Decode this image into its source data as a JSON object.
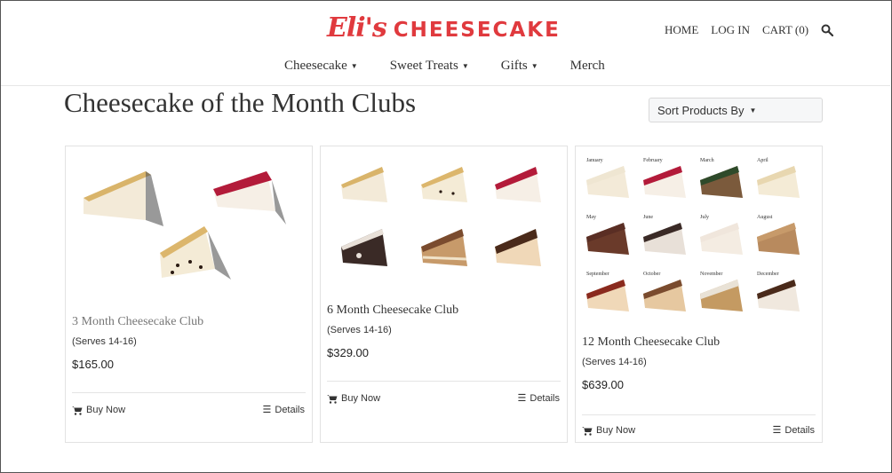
{
  "header": {
    "logo_script": "Eli's",
    "logo_word": "CHEESECAKE",
    "top_links": [
      "HOME",
      "LOG IN",
      "CART (0)"
    ],
    "nav": [
      "Cheesecake",
      "Sweet Treats",
      "Gifts",
      "Merch"
    ]
  },
  "page": {
    "title": "Cheesecake of the Month Clubs",
    "sort_label": "Sort Products By"
  },
  "products": [
    {
      "name": "3 Month Cheesecake Club",
      "serves": "(Serves 14-16)",
      "price": "$165.00",
      "buy": "Buy Now",
      "details": "Details"
    },
    {
      "name": "6 Month Cheesecake Club",
      "serves": "(Serves 14-16)",
      "price": "$329.00",
      "buy": "Buy Now",
      "details": "Details"
    },
    {
      "name": "12 Month Cheesecake Club",
      "serves": "(Serves 14-16)",
      "price": "$639.00",
      "buy": "Buy Now",
      "details": "Details"
    }
  ],
  "months": [
    "January",
    "February",
    "March",
    "April",
    "May",
    "June",
    "July",
    "August",
    "September",
    "October",
    "November",
    "December"
  ],
  "colors": {
    "brand": "#e03a3e",
    "muted_name": "#777777",
    "text": "#333333"
  }
}
